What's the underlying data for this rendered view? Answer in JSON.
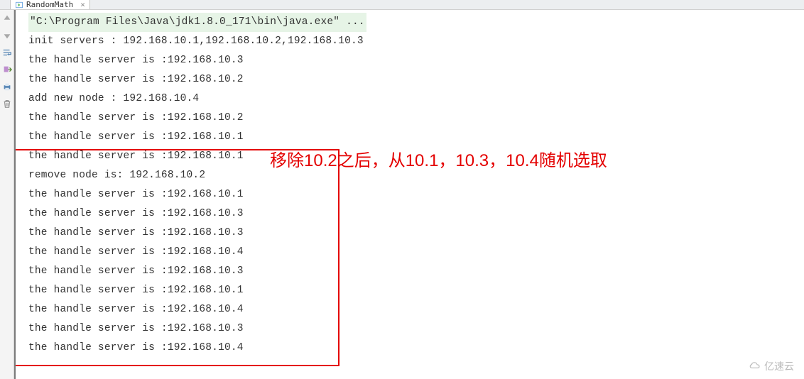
{
  "tab": {
    "title": "RandomMath",
    "icon": "run-config-icon"
  },
  "gutter": {
    "icons": [
      "up-arrow-icon",
      "down-arrow-icon",
      "wrap-icon",
      "export-icon",
      "print-icon",
      "trash-icon"
    ]
  },
  "console": {
    "cmd": "\"C:\\Program Files\\Java\\jdk1.8.0_171\\bin\\java.exe\" ...",
    "lines": [
      "init servers :  192.168.10.1,192.168.10.2,192.168.10.3",
      "the handle server is :192.168.10.3",
      "the handle server is :192.168.10.2",
      "add new node :  192.168.10.4",
      "the handle server is :192.168.10.2",
      "the handle server is :192.168.10.1",
      "the handle server is :192.168.10.1",
      "remove node is:  192.168.10.2",
      "the handle server is :192.168.10.1",
      "the handle server is :192.168.10.3",
      "the handle server is :192.168.10.3",
      "the handle server is :192.168.10.4",
      "the handle server is :192.168.10.3",
      "the handle server is :192.168.10.1",
      "the handle server is :192.168.10.4",
      "the handle server is :192.168.10.3",
      "the handle server is :192.168.10.4"
    ]
  },
  "annotation": {
    "text": "移除10.2之后，从10.1，10.3，10.4随机选取"
  },
  "watermark": {
    "text": "亿速云"
  }
}
